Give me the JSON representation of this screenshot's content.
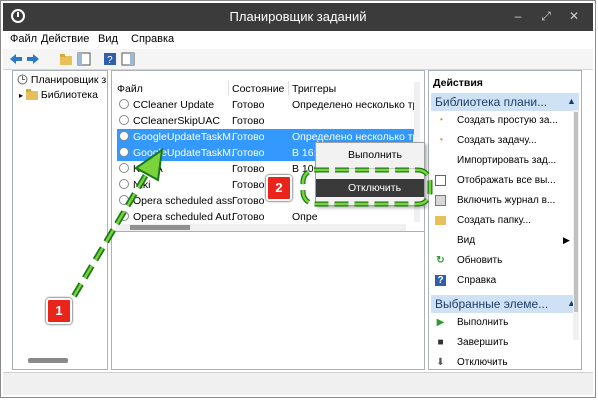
{
  "window": {
    "title": "Планировщик заданий",
    "minimize": "–",
    "restore": "⤢",
    "close": "✕"
  },
  "menu": [
    "Файл",
    "Действие",
    "Вид",
    "Справка"
  ],
  "tree": {
    "root": "Планировщик з",
    "child": "Библиотека"
  },
  "table": {
    "columns": [
      "Файл",
      "Состояние",
      "Триггеры"
    ],
    "rows": [
      {
        "name": "CCleaner Update",
        "state": "Готово",
        "trigger": "Определено несколько тр"
      },
      {
        "name": "CCleanerSkipUAC",
        "state": "Готово",
        "trigger": ""
      },
      {
        "name": "GoogleUpdateTaskM...",
        "state": "Готово",
        "trigger": "Определено несколько тр"
      },
      {
        "name": "GoogleUpdateTaskM...",
        "state": "Готово",
        "trigger": "В 16:2"
      },
      {
        "name": "KMSA",
        "state": "Готово",
        "trigger": "В 10:0"
      },
      {
        "name": "Niki",
        "state": "Готово",
        "trigger": ""
      },
      {
        "name": "Opera scheduled assi...",
        "state": "Готово",
        "trigger": ""
      },
      {
        "name": "Opera scheduled Aut...",
        "state": "Готово",
        "trigger": "Опре"
      }
    ]
  },
  "context_menu": {
    "items": [
      "Выполнить",
      "Отключить"
    ],
    "highlighted_index": 1
  },
  "actions": {
    "header": "Действия",
    "section1": {
      "title": "Библиотека плани...",
      "items": [
        {
          "label": "Создать простую за...",
          "icon": "create-basic-task-icon"
        },
        {
          "label": "Создать задачу...",
          "icon": "create-task-icon"
        },
        {
          "label": "Импортировать зад...",
          "icon": ""
        },
        {
          "label": "Отображать все вы...",
          "icon": "show-running-icon"
        },
        {
          "label": "Включить журнал в...",
          "icon": "enable-log-icon"
        },
        {
          "label": "Создать папку...",
          "icon": "new-folder-icon"
        },
        {
          "label": "Вид",
          "icon": ""
        },
        {
          "label": "Обновить",
          "icon": "refresh-icon"
        },
        {
          "label": "Справка",
          "icon": "help-icon"
        }
      ]
    },
    "section2": {
      "title": "Выбранные элеме...",
      "items": [
        {
          "label": "Выполнить",
          "icon": "run-icon"
        },
        {
          "label": "Завершить",
          "icon": "stop-icon"
        },
        {
          "label": "Отключить",
          "icon": "disable-icon"
        }
      ]
    }
  },
  "annotations": {
    "badge1": "1",
    "badge2": "2"
  },
  "colors": {
    "selection": "#3399ff",
    "titlebar": "#3b3b3b",
    "section": "#cfe2f5",
    "badge": "#e8241b",
    "arrow": "#1a7a1a",
    "arrow_fill": "#7bd33b"
  }
}
